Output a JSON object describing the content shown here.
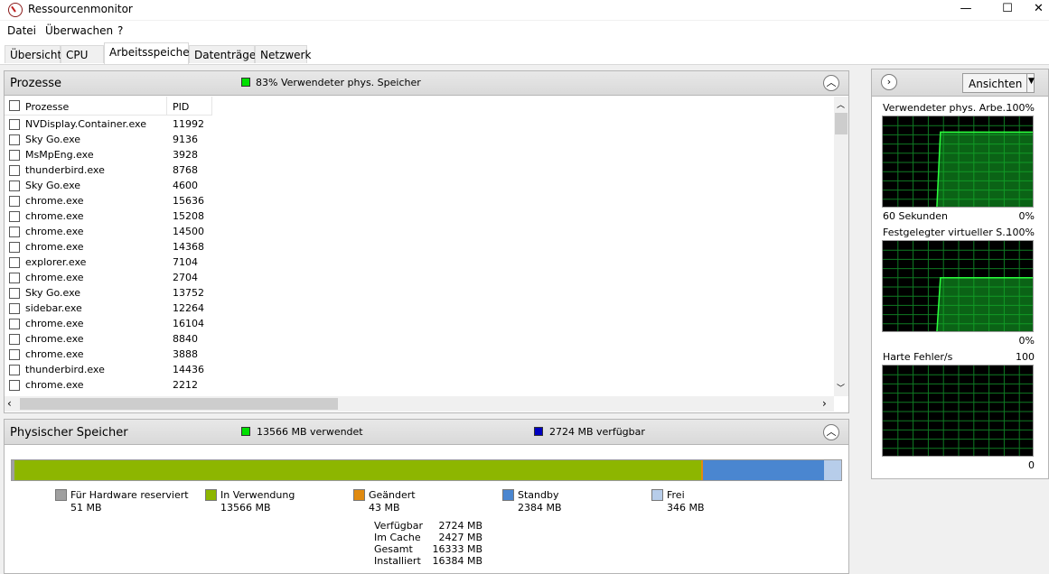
{
  "window": {
    "title": "Ressourcenmonitor",
    "minimize_glyph": "—",
    "maximize_glyph": "☐",
    "close_glyph": "✕"
  },
  "menu": [
    "Datei",
    "Überwachen",
    "?"
  ],
  "tabs": [
    "Übersicht",
    "CPU",
    "Arbeitsspeicher",
    "Datenträger",
    "Netzwerk"
  ],
  "active_tab": "Arbeitsspeicher",
  "processes": {
    "title": "Prozesse",
    "status": "83% Verwendeter phys. Speicher",
    "status_color": "#00e000",
    "col_process": "Prozesse",
    "col_pid": "PID",
    "rows": [
      {
        "name": "NVDisplay.Container.exe",
        "pid": "11992"
      },
      {
        "name": "Sky Go.exe",
        "pid": "9136"
      },
      {
        "name": "MsMpEng.exe",
        "pid": "3928"
      },
      {
        "name": "thunderbird.exe",
        "pid": "8768"
      },
      {
        "name": "Sky Go.exe",
        "pid": "4600"
      },
      {
        "name": "chrome.exe",
        "pid": "15636"
      },
      {
        "name": "chrome.exe",
        "pid": "15208"
      },
      {
        "name": "chrome.exe",
        "pid": "14500"
      },
      {
        "name": "chrome.exe",
        "pid": "14368"
      },
      {
        "name": "explorer.exe",
        "pid": "7104"
      },
      {
        "name": "chrome.exe",
        "pid": "2704"
      },
      {
        "name": "Sky Go.exe",
        "pid": "13752"
      },
      {
        "name": "sidebar.exe",
        "pid": "12264"
      },
      {
        "name": "chrome.exe",
        "pid": "16104"
      },
      {
        "name": "chrome.exe",
        "pid": "8840"
      },
      {
        "name": "chrome.exe",
        "pid": "3888"
      },
      {
        "name": "thunderbird.exe",
        "pid": "14436"
      },
      {
        "name": "chrome.exe",
        "pid": "2212"
      }
    ]
  },
  "physical": {
    "title": "Physischer Speicher",
    "used_label": "13566 MB verwendet",
    "used_color": "#00e000",
    "available_label": "2724 MB verfügbar",
    "available_color": "#0000c0",
    "bar": [
      {
        "key": "hardware",
        "label": "Für Hardware reserviert",
        "value": "51 MB",
        "mb": 51,
        "color": "#a0a0a0"
      },
      {
        "key": "inuse",
        "label": "In Verwendung",
        "value": "13566 MB",
        "mb": 13566,
        "color": "#8db600"
      },
      {
        "key": "modified",
        "label": "Geändert",
        "value": "43 MB",
        "mb": 43,
        "color": "#e08a10"
      },
      {
        "key": "standby",
        "label": "Standby",
        "value": "2384 MB",
        "mb": 2384,
        "color": "#4a86d0"
      },
      {
        "key": "free",
        "label": "Frei",
        "value": "346 MB",
        "mb": 346,
        "color": "#b7cdea"
      }
    ],
    "stats": [
      {
        "label": "Verfügbar",
        "value": "2724 MB"
      },
      {
        "label": "Im Cache",
        "value": "2427 MB"
      },
      {
        "label": "Gesamt",
        "value": "16333 MB"
      },
      {
        "label": "Installiert",
        "value": "16384 MB"
      }
    ]
  },
  "right": {
    "view_button": "Ansichten",
    "graphs": [
      {
        "title": "Verwendeter phys. Arbe...",
        "max": "100%",
        "bottom_left": "60 Sekunden",
        "bottom_right": "0%",
        "level": 0.83,
        "history_fraction": 0.62
      },
      {
        "title": "Festgelegter virtueller S...",
        "max": "100%",
        "bottom_left": "",
        "bottom_right": "0%",
        "level": 0.6,
        "history_fraction": 0.62
      },
      {
        "title": "Harte Fehler/s",
        "max": "100",
        "bottom_left": "",
        "bottom_right": "0",
        "level": 0.0,
        "history_fraction": 0.62
      }
    ]
  }
}
